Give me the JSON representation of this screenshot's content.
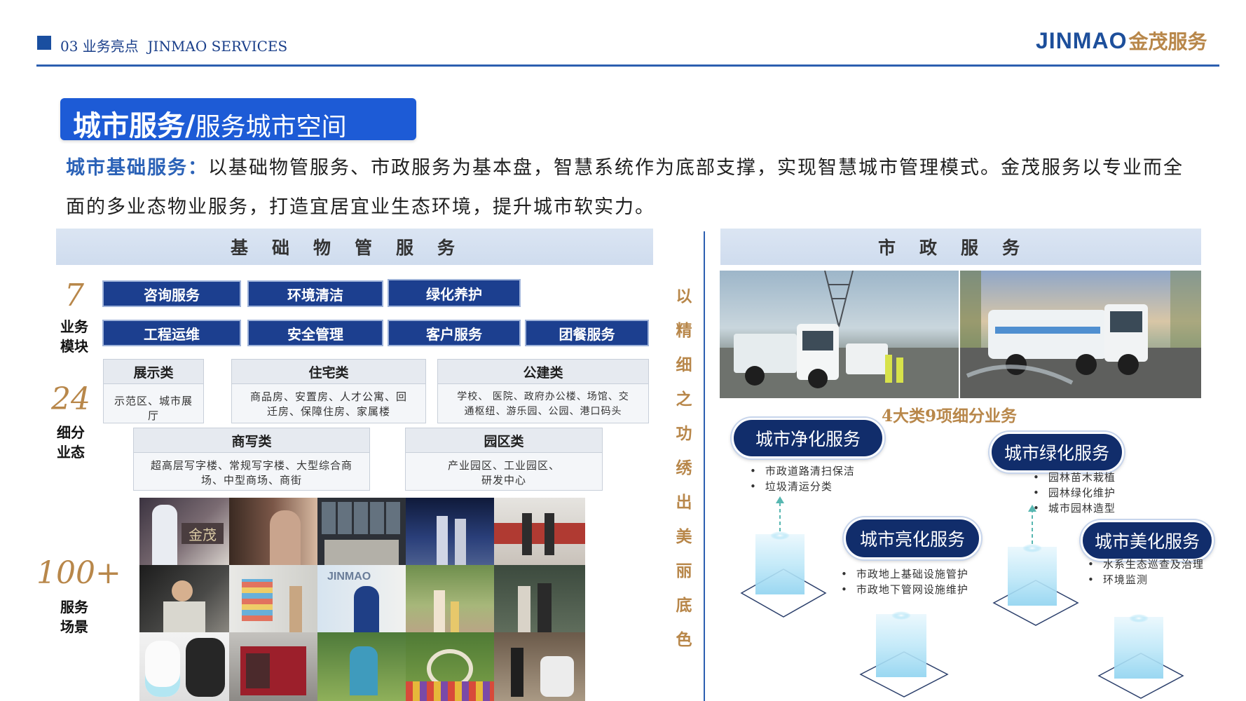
{
  "header": {
    "section": "03 业务亮点",
    "section_en": "JINMAO SERVICES",
    "logo_en": "JINMAO",
    "logo_cn": "金茂服务"
  },
  "title": {
    "main": "城市服务",
    "sep": "/",
    "sub": "服务城市空间"
  },
  "intro": {
    "lead": "城市基础服务：",
    "text": "以基础物管服务、市政服务为基本盘，智慧系统作为底部支撑，实现智慧城市管理模式。金茂服务以专业而全面的多业态物业服务，打造宜居宜业生态环境，提升城市软实力。"
  },
  "left": {
    "band_title": "基础物管服务",
    "stat_modules": {
      "number": "7",
      "label1": "业务",
      "label2": "模块"
    },
    "stat_formats": {
      "number": "24",
      "label1": "细分",
      "label2": "业态"
    },
    "stat_scenes": {
      "number": "100+",
      "label1": "服务",
      "label2": "场景"
    },
    "modules": [
      "咨询服务",
      "环境清洁",
      "绿化养护",
      "工程运维",
      "安全管理",
      "客户服务",
      "团餐服务"
    ],
    "categories": [
      {
        "name": "展示类",
        "lines": [
          "示范区、城市展厅"
        ]
      },
      {
        "name": "住宅类",
        "lines": [
          "商品房、安置房、人才公寓、回",
          "迁房、保障住房、家属楼"
        ]
      },
      {
        "name": "公建类",
        "lines": [
          "学校、 医院、政府办公楼、场馆、交",
          "通枢纽、游乐园、公园、港口码头"
        ]
      },
      {
        "name": "商写类",
        "lines": [
          "超高层写字楼、常规写字楼、大型综合商",
          "场、中型商场、商街"
        ]
      },
      {
        "name": "园区类",
        "lines": [
          "产业园区、工业园区、",
          "研发中心"
        ]
      }
    ],
    "photo_logo_text": "JINMAO"
  },
  "slogan": [
    "以",
    "精",
    "细",
    "之",
    "功",
    "绣",
    "出",
    "美",
    "丽",
    "底",
    "色"
  ],
  "right": {
    "band_title": "市政服务",
    "category_count": "4大类9项细分业务",
    "services": [
      {
        "name": "城市净化服务",
        "items": [
          "市政道路清扫保洁",
          "垃圾清运分类"
        ]
      },
      {
        "name": "城市绿化服务",
        "items": [
          "园林苗木栽植",
          "园林绿化维护",
          "城市园林造型"
        ]
      },
      {
        "name": "城市亮化服务",
        "items": [
          "市政地上基础设施管护",
          "市政地下管网设施维护"
        ]
      },
      {
        "name": "城市美化服务",
        "items": [
          "水系生态巡查及治理",
          "环境监测"
        ]
      }
    ]
  },
  "colors": {
    "primary_blue": "#1d5bd6",
    "navy": "#1c3f8f",
    "gold": "#b8874a",
    "band": "#d5e0f0"
  }
}
